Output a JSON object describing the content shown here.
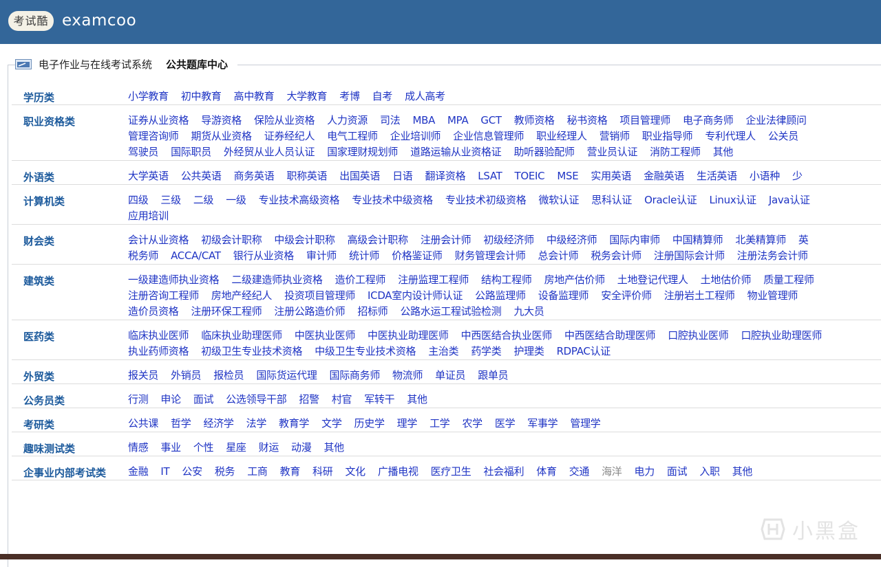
{
  "header": {
    "logo_badge": "考试酷",
    "logo_text": "examcoo",
    "bg_color": "#336699"
  },
  "legend": {
    "system": "电子作业与在线考试系统",
    "center": "公共题库中心"
  },
  "categories": [
    {
      "name": "学历类",
      "lines": [
        [
          "小学教育",
          "初中教育",
          "高中教育",
          "大学教育",
          "考博",
          "自考",
          "成人高考"
        ]
      ]
    },
    {
      "name": "职业资格类",
      "lines": [
        [
          "证券从业资格",
          "导游资格",
          "保险从业资格",
          "人力资源",
          "司法",
          "MBA",
          "MPA",
          "GCT",
          "教师资格",
          "秘书资格",
          "项目管理师",
          "电子商务师",
          "企业法律顾问"
        ],
        [
          "管理咨询师",
          "期货从业资格",
          "证券经纪人",
          "电气工程师",
          "企业培训师",
          "企业信息管理师",
          "职业经理人",
          "营销师",
          "职业指导师",
          "专利代理人",
          "公关员"
        ],
        [
          "驾驶员",
          "国际职员",
          "外经贸从业人员认证",
          "国家理财规划师",
          "道路运输从业资格证",
          "助听器验配师",
          "营业员认证",
          "消防工程师",
          "其他"
        ]
      ]
    },
    {
      "name": "外语类",
      "lines": [
        [
          "大学英语",
          "公共英语",
          "商务英语",
          "职称英语",
          "出国英语",
          "日语",
          "翻译资格",
          "LSAT",
          "TOEIC",
          "MSE",
          "实用英语",
          "金融英语",
          "生活英语",
          "小语种",
          "少"
        ]
      ]
    },
    {
      "name": "计算机类",
      "lines": [
        [
          "四级",
          "三级",
          "二级",
          "一级",
          "专业技术高级资格",
          "专业技术中级资格",
          "专业技术初级资格",
          "微软认证",
          "思科认证",
          "Oracle认证",
          "Linux认证",
          "Java认证"
        ],
        [
          "应用培训"
        ]
      ]
    },
    {
      "name": "财会类",
      "lines": [
        [
          "会计从业资格",
          "初级会计职称",
          "中级会计职称",
          "高级会计职称",
          "注册会计师",
          "初级经济师",
          "中级经济师",
          "国际内审师",
          "中国精算师",
          "北美精算师",
          "英"
        ],
        [
          "税务师",
          "ACCA/CAT",
          "银行从业资格",
          "审计师",
          "统计师",
          "价格鉴证师",
          "财务管理会计师",
          "总会计师",
          "税务会计师",
          "注册国际会计师",
          "注册法务会计师"
        ]
      ]
    },
    {
      "name": "建筑类",
      "lines": [
        [
          "一级建造师执业资格",
          "二级建造师执业资格",
          "造价工程师",
          "注册监理工程师",
          "结构工程师",
          "房地产估价师",
          "土地登记代理人",
          "土地估价师",
          "质量工程师"
        ],
        [
          "注册咨询工程师",
          "房地产经纪人",
          "投资项目管理师",
          "ICDA室内设计师认证",
          "公路监理师",
          "设备监理师",
          "安全评价师",
          "注册岩土工程师",
          "物业管理师"
        ],
        [
          "造价员资格",
          "注册环保工程师",
          "注册公路造价师",
          "招标师",
          "公路水运工程试验检测",
          "九大员"
        ]
      ]
    },
    {
      "name": "医药类",
      "lines": [
        [
          "临床执业医师",
          "临床执业助理医师",
          "中医执业医师",
          "中医执业助理医师",
          "中西医结合执业医师",
          "中西医结合助理医师",
          "口腔执业医师",
          "口腔执业助理医师"
        ],
        [
          "执业药师资格",
          "初级卫生专业技术资格",
          "中级卫生专业技术资格",
          "主治类",
          "药学类",
          "护理类",
          "RDPAC认证"
        ]
      ]
    },
    {
      "name": "外贸类",
      "lines": [
        [
          "报关员",
          "外销员",
          "报检员",
          "国际货运代理",
          "国际商务师",
          "物流师",
          "单证员",
          "跟单员"
        ]
      ]
    },
    {
      "name": "公务员类",
      "lines": [
        [
          "行测",
          "申论",
          "面试",
          "公选领导干部",
          "招警",
          "村官",
          "军转干",
          "其他"
        ]
      ]
    },
    {
      "name": "考研类",
      "lines": [
        [
          "公共课",
          "哲学",
          "经济学",
          "法学",
          "教育学",
          "文学",
          "历史学",
          "理学",
          "工学",
          "农学",
          "医学",
          "军事学",
          "管理学"
        ]
      ]
    },
    {
      "name": "趣味测试类",
      "lines": [
        [
          "情感",
          "事业",
          "个性",
          "星座",
          "财运",
          "动漫",
          "其他"
        ]
      ]
    },
    {
      "name": "企事业内部考试类",
      "lines": [
        [
          "金融",
          "IT",
          "公安",
          "税务",
          "工商",
          "教育",
          "科研",
          "文化",
          "广播电视",
          "医疗卫生",
          "社会福利",
          "体育",
          "交通",
          "海洋",
          "电力",
          "面试",
          "入职",
          "其他"
        ]
      ]
    }
  ],
  "muted_items": [
    "海洋"
  ],
  "watermark": {
    "text": "小黑盒",
    "icon": "heybox-logo-icon"
  }
}
